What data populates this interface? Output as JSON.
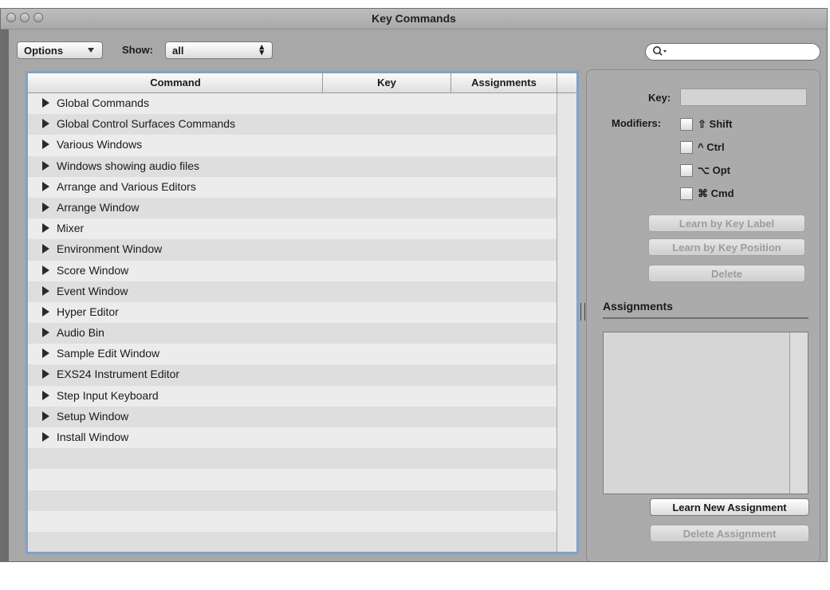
{
  "window": {
    "title": "Key Commands"
  },
  "toolbar": {
    "options_label": "Options",
    "show_label": "Show:",
    "show_value": "all"
  },
  "table": {
    "headers": {
      "command": "Command",
      "key": "Key",
      "assignments": "Assignments"
    },
    "rows": [
      "Global Commands",
      "Global Control Surfaces Commands",
      "Various Windows",
      "Windows showing audio files",
      "Arrange and Various Editors",
      "Arrange Window",
      "Mixer",
      "Environment Window",
      "Score Window",
      "Event Window",
      "Hyper Editor",
      "Audio Bin",
      "Sample Edit Window",
      "EXS24 Instrument Editor",
      "Step Input Keyboard",
      "Setup Window",
      "Install Window",
      "",
      "",
      "",
      "",
      "",
      ""
    ]
  },
  "panel": {
    "key_label": "Key:",
    "modifiers_label": "Modifiers:",
    "modifiers": [
      {
        "symbol": "⇧",
        "label": "Shift"
      },
      {
        "symbol": "^",
        "label": "Ctrl"
      },
      {
        "symbol": "⌥",
        "label": "Opt"
      },
      {
        "symbol": "⌘",
        "label": "Cmd"
      }
    ],
    "learn_key_label": "Learn by Key Label",
    "learn_key_position": "Learn by Key Position",
    "delete": "Delete",
    "assignments_title": "Assignments",
    "learn_new_assignment": "Learn New Assignment",
    "delete_assignment": "Delete Assignment"
  }
}
